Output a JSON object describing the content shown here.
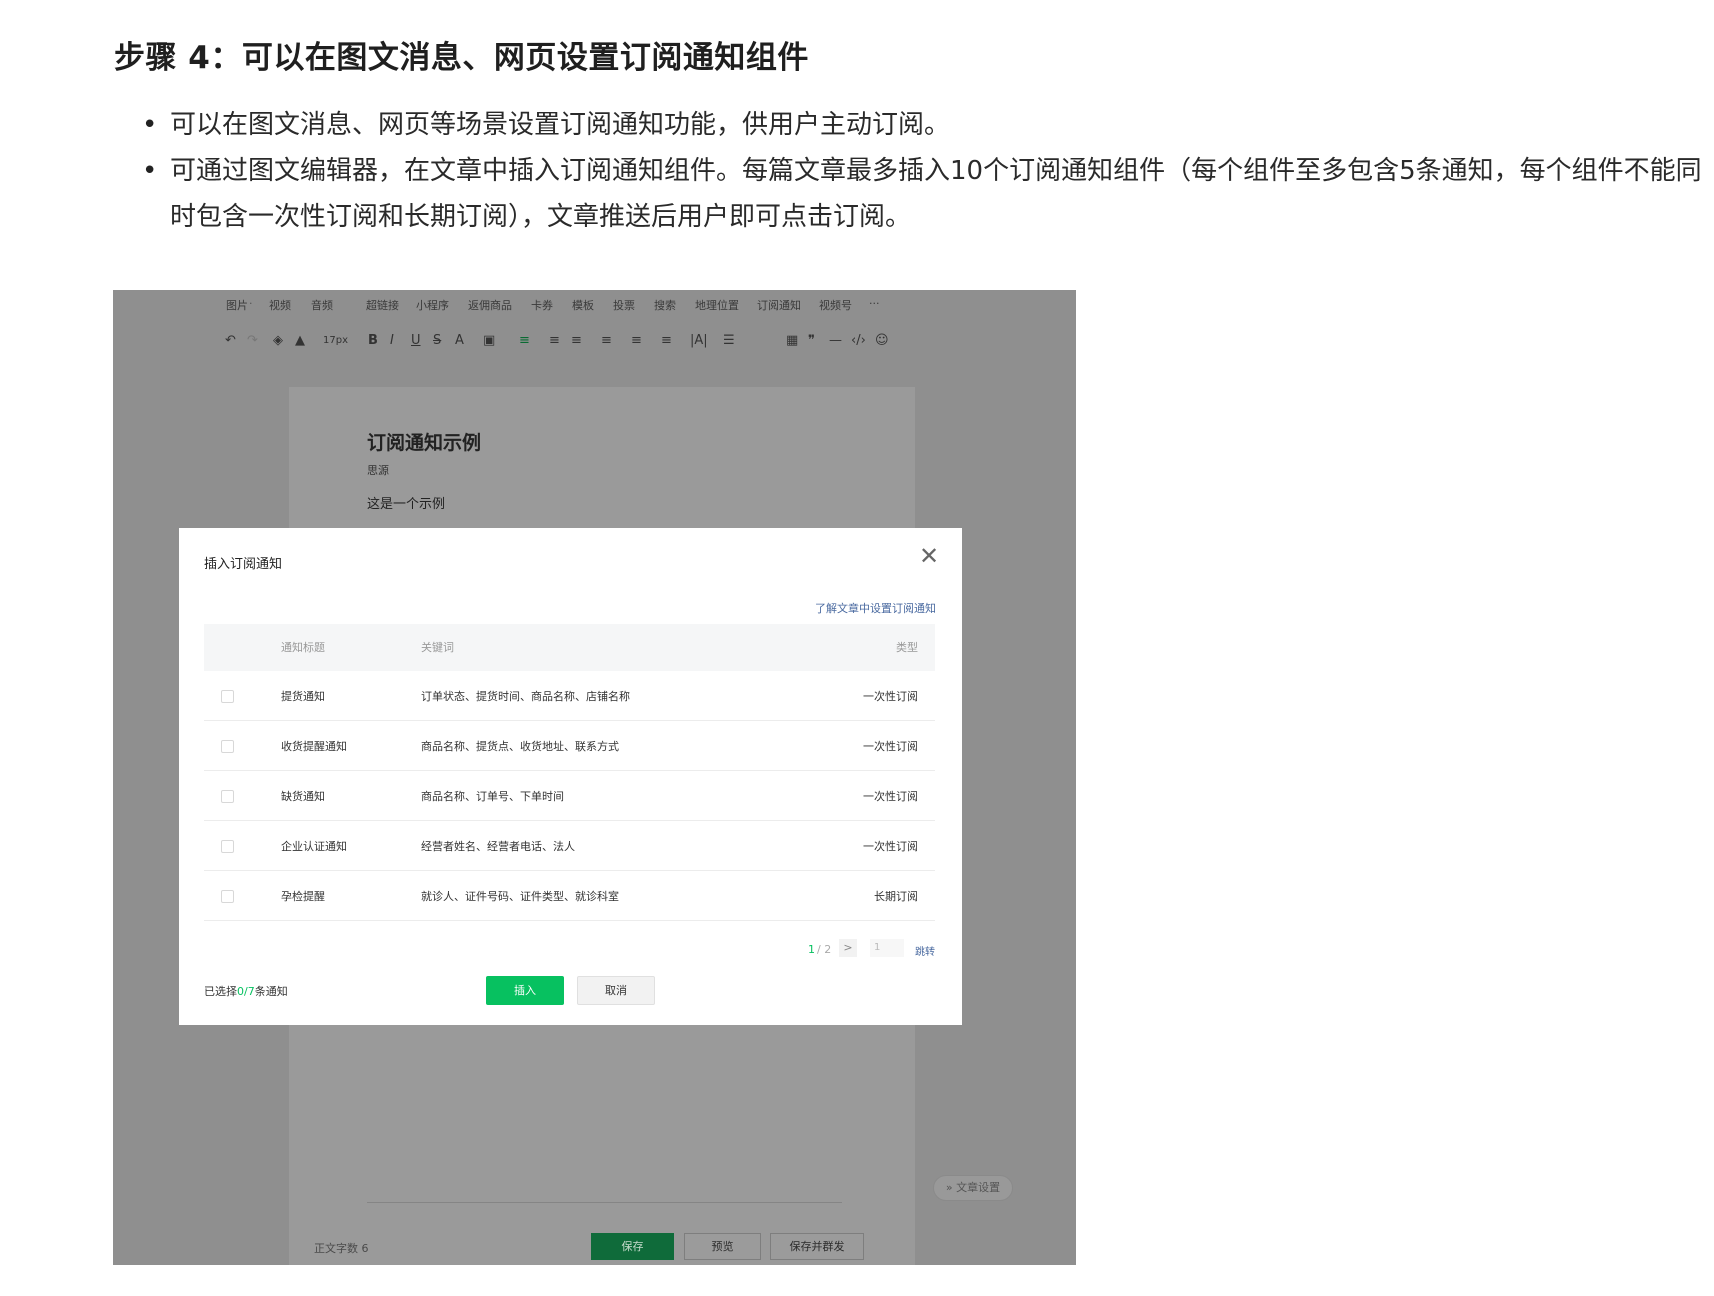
{
  "doc": {
    "title": "步骤 4：可以在图文消息、网页设置订阅通知组件",
    "bullets": [
      "可以在图文消息、网页等场景设置订阅通知功能，供用户主动订阅。",
      "可通过图文编辑器，在文章中插入订阅通知组件。每篇文章最多插入10个订阅通知组件（每个组件至多包含5条通知，每个组件不能同时包含一次性订阅和长期订阅），文章推送后用户即可点击订阅。"
    ]
  },
  "editor": {
    "menu": [
      "图片",
      "视频",
      "音频",
      "超链接",
      "小程序",
      "返佣商品",
      "卡券",
      "模板",
      "投票",
      "搜索",
      "地理位置",
      "订阅通知",
      "视频号",
      "···"
    ],
    "font_size": "17px",
    "article_title": "订阅通知示例",
    "article_author": "思源",
    "article_body": "这是一个示例",
    "word_count_label": "正文字数  6",
    "article_settings": "文章设置",
    "buttons": {
      "save": "保存",
      "preview": "预览",
      "save_send": "保存并群发"
    }
  },
  "modal": {
    "title": "插入订阅通知",
    "help_link": "了解文章中设置订阅通知",
    "columns": {
      "title": "通知标题",
      "keywords": "关键词",
      "type": "类型"
    },
    "rows": [
      {
        "title": "提货通知",
        "keywords": "订单状态、提货时间、商品名称、店铺名称",
        "type": "一次性订阅"
      },
      {
        "title": "收货提醒通知",
        "keywords": "商品名称、提货点、收货地址、联系方式",
        "type": "一次性订阅"
      },
      {
        "title": "缺货通知",
        "keywords": "商品名称、订单号、下单时间",
        "type": "一次性订阅"
      },
      {
        "title": "企业认证通知",
        "keywords": "经营者姓名、经营者电话、法人",
        "type": "一次性订阅"
      },
      {
        "title": "孕检提醒",
        "keywords": "就诊人、证件号码、证件类型、就诊科室",
        "type": "长期订阅"
      }
    ],
    "pager": {
      "current": "1",
      "total": "/ 2",
      "next": ">",
      "jump_value": "1",
      "jump_label": "跳转"
    },
    "selection": {
      "prefix": "已选择",
      "count": "0/7",
      "suffix": "条通知"
    },
    "insert_label": "插入",
    "cancel_label": "取消"
  },
  "colors": {
    "accent": "#07c160",
    "link": "#4a6aa0",
    "overlay": "#8f8f8f"
  }
}
